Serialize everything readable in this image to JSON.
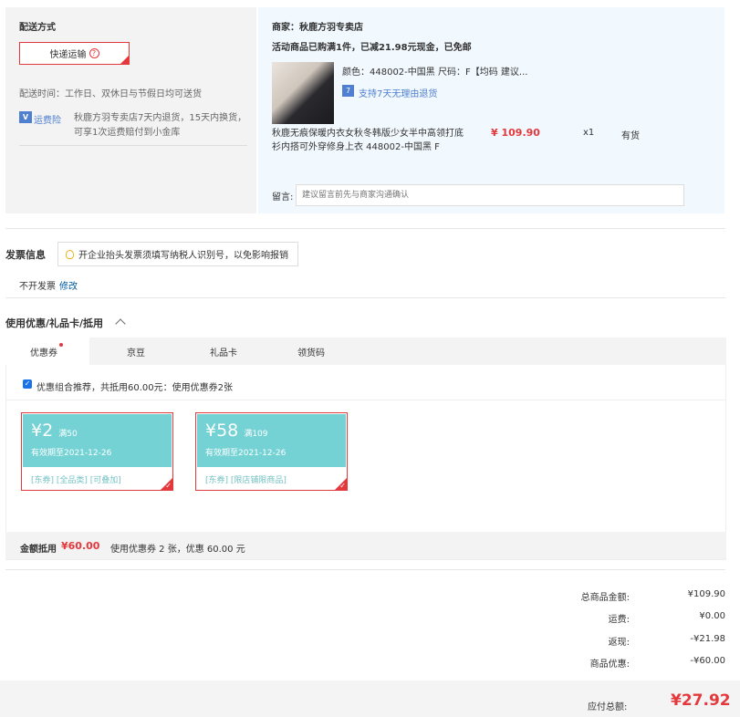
{
  "shipping": {
    "title": "配送方式",
    "method": "快递运输",
    "help_glyph": "?",
    "time": "配送时间：工作日、双休日与节假日均可送货",
    "insurance_badge": "V",
    "insurance_label": "运费险",
    "insurance_text": "秋鹿方羽专卖店7天内退货，15天内换货，可享1次运费赔付到小金库"
  },
  "store": {
    "name": "商家：秋鹿方羽专卖店",
    "promo": "活动商品已购满1件，已减21.98元现金，已免邮",
    "item": {
      "sku": "颜色：448002-中国黑  尺码：F【均码 建议...",
      "return_badge": "7",
      "return_policy": "支持7天无理由退货",
      "title": "秋鹿无痕保暖内衣女秋冬韩版少女半中高领打底衫内搭可外穿修身上衣 448002-中国黑 F",
      "price": "¥ 109.90",
      "qty": "x1",
      "stock": "有货"
    },
    "remark_label": "留言:",
    "remark_placeholder": "建议留言前先与商家沟通确认"
  },
  "invoice": {
    "title": "发票信息",
    "tip": "开企业抬头发票须填写纳税人识别号，以免影响报销",
    "value": "不开发票",
    "edit": "修改"
  },
  "coupons": {
    "title": "使用优惠/礼品卡/抵用",
    "tabs": [
      {
        "label": "优惠券"
      },
      {
        "label": "京豆"
      },
      {
        "label": "礼品卡"
      },
      {
        "label": "领货码"
      }
    ],
    "check_glyph": "✓",
    "combo_text": "优惠组合推荐，共抵用60.00元：使用优惠券2张",
    "items": [
      {
        "amount": "¥2",
        "condition": "满50",
        "expiry": "有效期至2021-12-26",
        "tags": "[东券]  [全品类]  [可叠加]"
      },
      {
        "amount": "¥58",
        "condition": "满109",
        "expiry": "有效期至2021-12-26",
        "tags": "[东券]  [限店铺限商品]"
      }
    ],
    "offset_label": "金额抵用",
    "offset_value": "¥60.00",
    "offset_desc": "使用优惠券 2 张，优惠 60.00 元"
  },
  "totals": {
    "goods_label": "总商品金额:",
    "goods_value": "¥109.90",
    "freight_label": "运费:",
    "freight_value": "¥0.00",
    "rebate_label": "返现:",
    "rebate_value": "-¥21.98",
    "coupon_label": "商品优惠:",
    "coupon_value": "-¥60.00",
    "pay_label": "应付总额:",
    "pay_value": "¥27.92"
  },
  "colors": {
    "accent_red": "#e4393c",
    "coupon_teal": "#74d2d4",
    "link_blue": "#005aa0",
    "panel_blue": "#f1f8fe"
  }
}
